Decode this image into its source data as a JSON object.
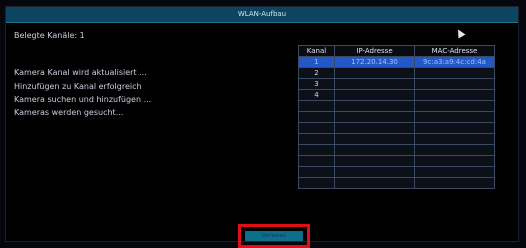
{
  "window": {
    "title": "WLAN-Aufbau"
  },
  "left": {
    "occupied_channels_label": "Belegte Kanäle: 1",
    "status_lines": [
      "Kamera Kanal wird aktualisiert ...",
      "Hinzufügen zu Kanal erfolgreich",
      "Kamera suchen und hinzufügen ...",
      "Kameras werden gesucht..."
    ]
  },
  "table": {
    "headers": [
      "Kanal",
      "IP-Adresse",
      "MAC-Adresse"
    ],
    "rows": [
      [
        "1",
        "172.20.14.30",
        "9c:a3:a9:4c:cd:4a"
      ],
      [
        "2",
        "",
        ""
      ],
      [
        "3",
        "",
        ""
      ],
      [
        "4",
        "",
        ""
      ],
      [
        "",
        "",
        ""
      ],
      [
        "",
        "",
        ""
      ],
      [
        "",
        "",
        ""
      ],
      [
        "",
        "",
        ""
      ],
      [
        "",
        "",
        ""
      ],
      [
        "",
        "",
        ""
      ],
      [
        "",
        "",
        ""
      ],
      [
        "",
        "",
        ""
      ]
    ],
    "selected_row": 0
  },
  "footer": {
    "button_label": "Verlassen"
  },
  "colors": {
    "titlebar": "#0d4560",
    "selected_row": "#2458c9",
    "highlight_box": "#e10f14",
    "button": "#0e6f8d"
  }
}
